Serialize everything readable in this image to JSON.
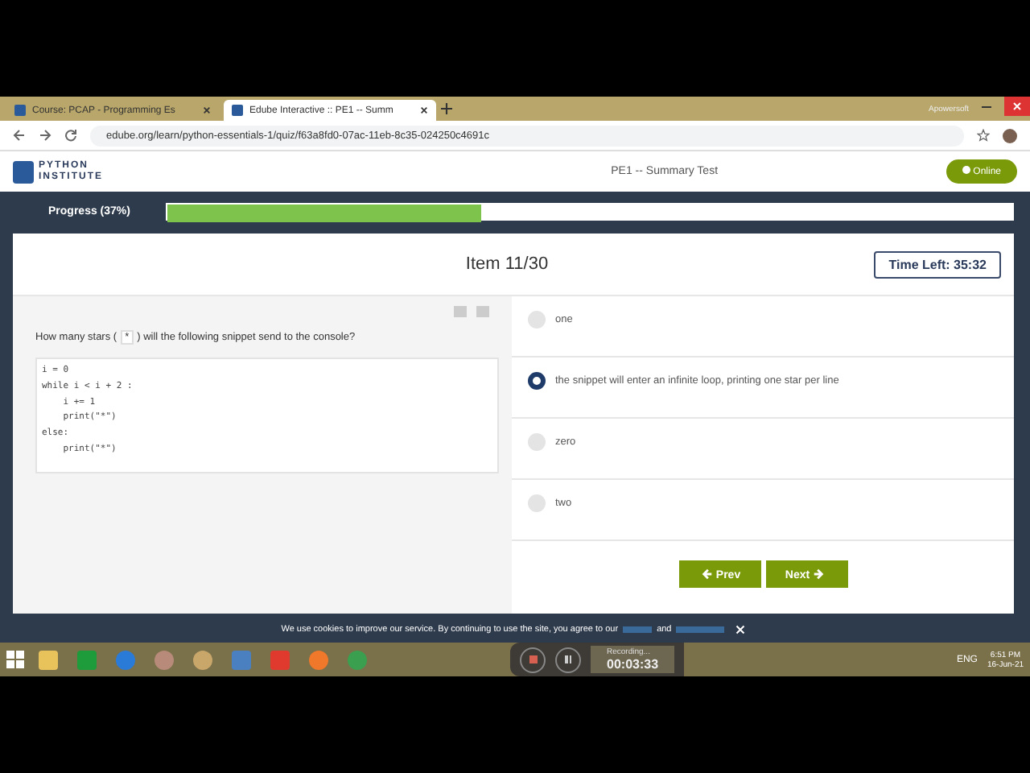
{
  "browser": {
    "tabs": [
      {
        "title": "Course: PCAP - Programming Es",
        "selected": false
      },
      {
        "title": "Edube Interactive :: PE1 -- Summ",
        "selected": true
      }
    ],
    "url": "edube.org/learn/python-essentials-1/quiz/f63a8fd0-07ac-11eb-8c35-024250c4691c",
    "recorder_label": "Apowersoft"
  },
  "header": {
    "logo_line1": "PYTHON",
    "logo_line2": "INSTITUTE",
    "title": "PE1 -- Summary Test",
    "status": "Online"
  },
  "progress": {
    "label": "Progress (37%)",
    "level": 0.37
  },
  "quiz": {
    "item": "Item 11/30",
    "timer": "Time Left: 35:32",
    "question": {
      "before": "How many stars (",
      "code": "*",
      "after": ") will the following snippet send to the console?"
    },
    "code_lines": [
      "i = 0",
      "while i < i + 2 :",
      "    i += 1",
      "    print(\"*\")",
      "else:",
      "    print(\"*\")"
    ],
    "answers": [
      {
        "text": "one",
        "selected": false
      },
      {
        "text": "the snippet will enter an infinite loop, printing one star per line",
        "selected": true
      },
      {
        "text": "zero",
        "selected": false
      },
      {
        "text": "two",
        "selected": false
      }
    ],
    "prev": "Prev",
    "next": "Next"
  },
  "cookie": {
    "text": "We use cookies to improve our service. By continuing to use the site, you agree to our",
    "and": "and"
  },
  "taskbar": {
    "recording": "Recording...",
    "elapsed": "00:03:33",
    "lang": "ENG",
    "time": "6:51 PM",
    "date": "16-Jun-21"
  }
}
